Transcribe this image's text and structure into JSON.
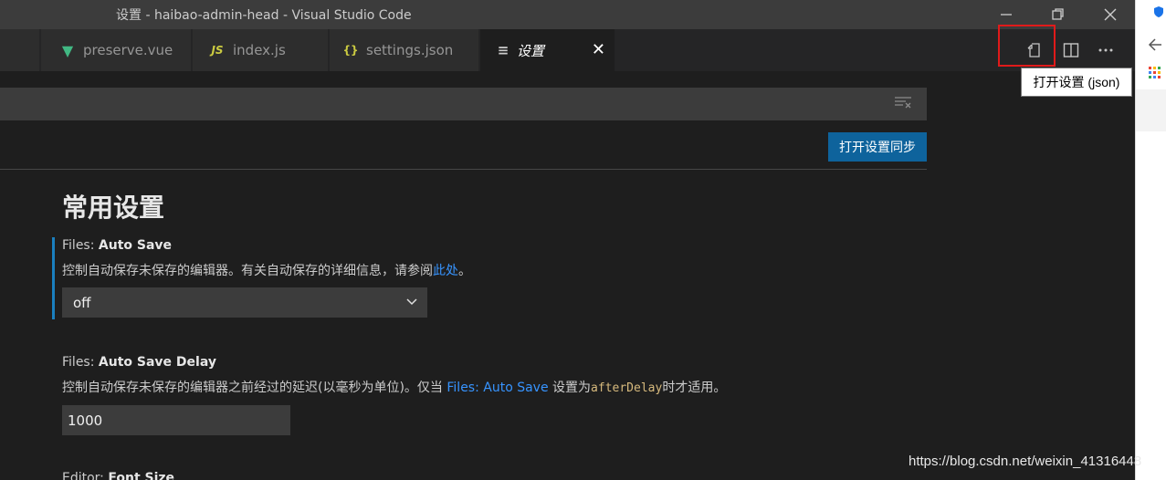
{
  "window": {
    "title": "设置 - haibao-admin-head - Visual Studio Code"
  },
  "tabs": [
    {
      "label": "preserve.vue",
      "icon": "vue-icon",
      "icon_glyph": "V",
      "icon_color": "#41b883"
    },
    {
      "label": "index.js",
      "icon": "js-icon",
      "icon_glyph": "JS",
      "icon_color": "#cbcb41"
    },
    {
      "label": "settings.json",
      "icon": "json-icon",
      "icon_glyph": "{}",
      "icon_color": "#cbcb41"
    },
    {
      "label": "设置",
      "icon": "settings-list-icon",
      "icon_glyph": "≡",
      "icon_color": "#cccccc",
      "active": true,
      "close_glyph": "✕"
    }
  ],
  "tooltip": {
    "text": "打开设置 (json)"
  },
  "search": {
    "value": ""
  },
  "sync_button": {
    "label": "打开设置同步"
  },
  "section": {
    "title": "常用设置"
  },
  "settings": [
    {
      "category": "Files: ",
      "name": "Auto Save",
      "description_prefix": "控制自动保存未保存的编辑器。有关自动保存的详细信息，请参阅",
      "description_link": "此处",
      "description_suffix": "。",
      "control": "select",
      "value": "off"
    },
    {
      "category": "Files: ",
      "name": "Auto Save Delay",
      "description_prefix": "控制自动保存未保存的编辑器之前经过的延迟(以毫秒为单位)。仅当 ",
      "description_link": "Files: Auto Save",
      "description_middle": " 设置为",
      "description_code": "afterDelay",
      "description_suffix": "时才适用。",
      "control": "input",
      "value": "1000"
    },
    {
      "category": "Editor: ",
      "name": "Font Size"
    }
  ],
  "watermark": "https://blog.csdn.net/weixin_41316448",
  "colors": {
    "accent": "#0e639c",
    "focus": "#1a7fbf",
    "highlight_box": "#e01a1a",
    "link": "#3794ff"
  }
}
